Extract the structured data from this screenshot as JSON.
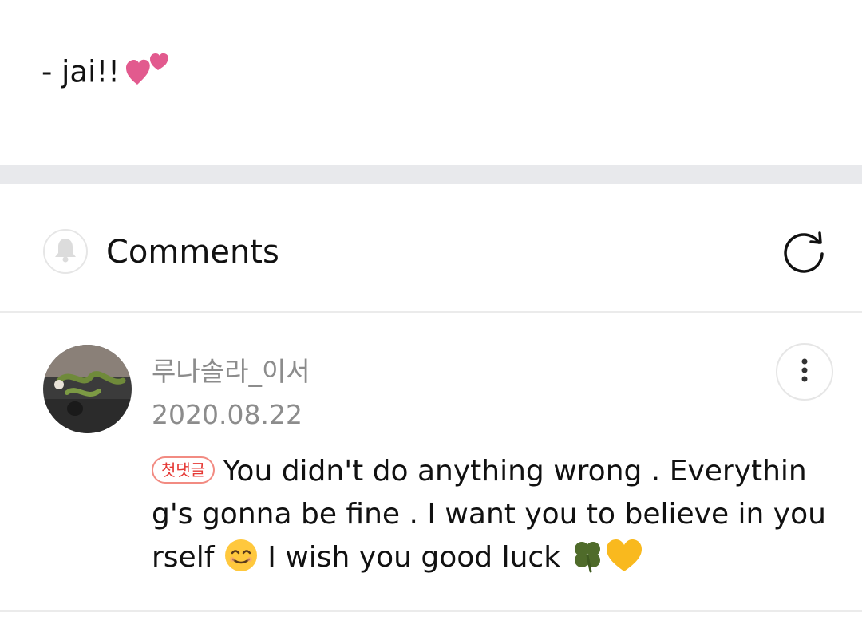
{
  "post": {
    "signature": "- jai!!",
    "signature_emoji": "two-hearts-icon"
  },
  "comments_section": {
    "title": "Comments",
    "bell_icon": "bell-icon",
    "refresh_icon": "refresh-icon"
  },
  "comment": {
    "author": "루나솔라_이서",
    "date": "2020.08.22",
    "badge": "첫댓글",
    "text_part1": "You didn't do anything wrong . Everything's gonna be fine . I want you to believe in yourself",
    "text_part2": "I wish you good luck",
    "emojis": [
      "smiling-face-icon",
      "four-leaf-clover-icon",
      "yellow-heart-icon"
    ],
    "menu_icon": "more-vertical-icon"
  },
  "colors": {
    "badge_red": "#e53935",
    "muted_text": "#8c8c8c",
    "divider": "#e8e9ec"
  }
}
